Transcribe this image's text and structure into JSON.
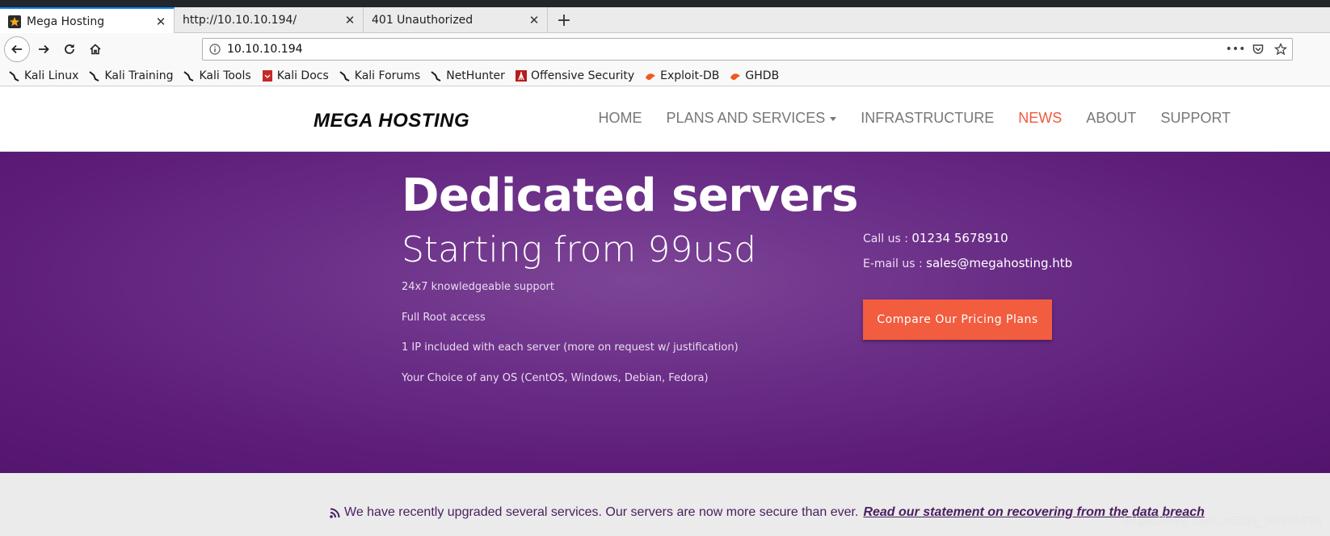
{
  "browser": {
    "tabs": [
      {
        "title": "Mega Hosting",
        "active": true
      },
      {
        "title": "http://10.10.10.194/",
        "active": false
      },
      {
        "title": "401 Unauthorized",
        "active": false
      }
    ],
    "url": "10.10.10.194",
    "bookmarks": [
      "Kali Linux",
      "Kali Training",
      "Kali Tools",
      "Kali Docs",
      "Kali Forums",
      "NetHunter",
      "Offensive Security",
      "Exploit-DB",
      "GHDB"
    ]
  },
  "site": {
    "logo": "MEGA HOSTING",
    "nav": [
      "HOME",
      "PLANS AND SERVICES",
      "INFRASTRUCTURE",
      "NEWS",
      "ABOUT",
      "SUPPORT"
    ],
    "active_nav": "NEWS",
    "accent_color": "#f25c3f",
    "hero": {
      "title": "Dedicated servers",
      "subtitle": "Starting from 99usd",
      "features": [
        "24x7 knowledgeable support",
        "Full Root access",
        "1 IP included with each server (more on request w/ justification)",
        "Your Choice of any OS (CentOS, Windows, Debian, Fedora)"
      ],
      "call_label": "Call us : ",
      "call_value": "01234 5678910",
      "email_label": "E-mail us : ",
      "email_value": "sales@megahosting.htb",
      "cta": "Compare Our Pricing Plans"
    },
    "notice": {
      "text": "We have recently upgraded several services. Our servers are now more secure than ever.",
      "link": "Read our statement on recovering from the data breach"
    }
  },
  "watermark": "https://blog.csdn.net/qq_38005854"
}
